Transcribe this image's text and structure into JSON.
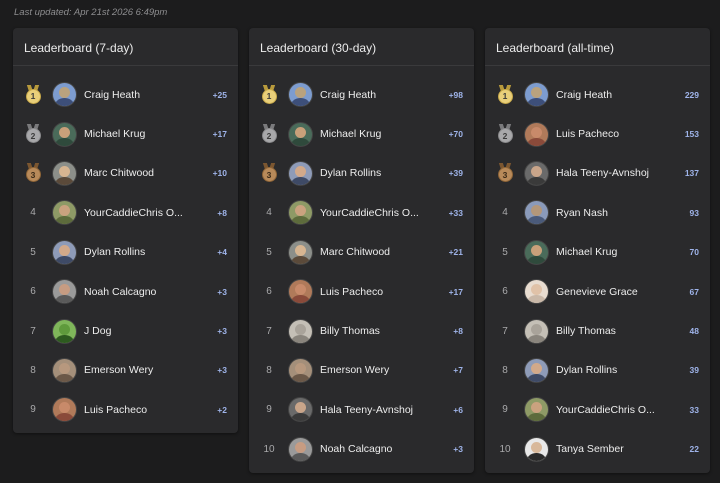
{
  "last_updated": "Last updated: Apr 21st 2026 6:49pm",
  "accent_color": "#9fb4ea",
  "medal_colors": {
    "gold": "#e9cf7a",
    "silver": "#a8a8aa",
    "bronze": "#b88a5a"
  },
  "boards": [
    {
      "title": "Leaderboard (7-day)",
      "rows": [
        {
          "rank": "1",
          "name": "Craig Heath",
          "score": "+25",
          "avatar": [
            "#b9a27e",
            "#3d4f7a",
            "#7d9ccf"
          ]
        },
        {
          "rank": "2",
          "name": "Michael Krug",
          "score": "+17",
          "avatar": [
            "#c9a07a",
            "#2f4a3c",
            "#4a6b5a"
          ]
        },
        {
          "rank": "3",
          "name": "Marc Chitwood",
          "score": "+10",
          "avatar": [
            "#d7b591",
            "#5b4a3a",
            "#8c8f8a"
          ]
        },
        {
          "rank": "4",
          "name": "YourCaddieChris O...",
          "score": "+8",
          "avatar": [
            "#caa27f",
            "#5d6b3c",
            "#8e9a66"
          ]
        },
        {
          "rank": "5",
          "name": "Dylan Rollins",
          "score": "+4",
          "avatar": [
            "#d2a98a",
            "#3e4a66",
            "#8e9bb8"
          ]
        },
        {
          "rank": "6",
          "name": "Noah Calcagno",
          "score": "+3",
          "avatar": [
            "#c79c82",
            "#5a5a5a",
            "#9a9a9a"
          ]
        },
        {
          "rank": "7",
          "name": "J Dog",
          "score": "+3",
          "avatar": [
            "#5f9a3c",
            "#2d5a1f",
            "#7fb65a"
          ]
        },
        {
          "rank": "8",
          "name": "Emerson Wery",
          "score": "+3",
          "avatar": [
            "#b7987e",
            "#6b5848",
            "#a48f7a"
          ]
        },
        {
          "rank": "9",
          "name": "Luis Pacheco",
          "score": "+2",
          "avatar": [
            "#c88a6a",
            "#8a4a3a",
            "#b07a5a"
          ]
        }
      ]
    },
    {
      "title": "Leaderboard (30-day)",
      "rows": [
        {
          "rank": "1",
          "name": "Craig Heath",
          "score": "+98",
          "avatar": [
            "#b9a27e",
            "#3d4f7a",
            "#7d9ccf"
          ]
        },
        {
          "rank": "2",
          "name": "Michael Krug",
          "score": "+70",
          "avatar": [
            "#c9a07a",
            "#2f4a3c",
            "#4a6b5a"
          ]
        },
        {
          "rank": "3",
          "name": "Dylan Rollins",
          "score": "+39",
          "avatar": [
            "#d2a98a",
            "#3e4a66",
            "#8e9bb8"
          ]
        },
        {
          "rank": "4",
          "name": "YourCaddieChris O...",
          "score": "+33",
          "avatar": [
            "#caa27f",
            "#5d6b3c",
            "#8e9a66"
          ]
        },
        {
          "rank": "5",
          "name": "Marc Chitwood",
          "score": "+21",
          "avatar": [
            "#d7b591",
            "#5b4a3a",
            "#8c8f8a"
          ]
        },
        {
          "rank": "6",
          "name": "Luis Pacheco",
          "score": "+17",
          "avatar": [
            "#c88a6a",
            "#8a4a3a",
            "#b07a5a"
          ]
        },
        {
          "rank": "7",
          "name": "Billy Thomas",
          "score": "+8",
          "avatar": [
            "#a9a39a",
            "#8a857d",
            "#c4bfb6"
          ]
        },
        {
          "rank": "8",
          "name": "Emerson Wery",
          "score": "+7",
          "avatar": [
            "#b7987e",
            "#6b5848",
            "#a48f7a"
          ]
        },
        {
          "rank": "9",
          "name": "Hala Teeny-Avnshoj",
          "score": "+6",
          "avatar": [
            "#c9a58a",
            "#3a3a3a",
            "#6a6a6a"
          ]
        },
        {
          "rank": "10",
          "name": "Noah Calcagno",
          "score": "+3",
          "avatar": [
            "#c79c82",
            "#5a5a5a",
            "#9a9a9a"
          ]
        }
      ]
    },
    {
      "title": "Leaderboard (all-time)",
      "rows": [
        {
          "rank": "1",
          "name": "Craig Heath",
          "score": "229",
          "avatar": [
            "#b9a27e",
            "#3d4f7a",
            "#7d9ccf"
          ]
        },
        {
          "rank": "2",
          "name": "Luis Pacheco",
          "score": "153",
          "avatar": [
            "#c88a6a",
            "#8a4a3a",
            "#b07a5a"
          ]
        },
        {
          "rank": "3",
          "name": "Hala Teeny-Avnshoj",
          "score": "137",
          "avatar": [
            "#c9a58a",
            "#3a3a3a",
            "#6a6a6a"
          ]
        },
        {
          "rank": "4",
          "name": "Ryan Nash",
          "score": "93",
          "avatar": [
            "#b3977a",
            "#4a5a7a",
            "#8a9aba"
          ]
        },
        {
          "rank": "5",
          "name": "Michael Krug",
          "score": "70",
          "avatar": [
            "#c9a07a",
            "#2f4a3c",
            "#4a6b5a"
          ]
        },
        {
          "rank": "6",
          "name": "Genevieve Grace",
          "score": "67",
          "avatar": [
            "#e0c2a8",
            "#c9b8a8",
            "#e8dcd0"
          ]
        },
        {
          "rank": "7",
          "name": "Billy Thomas",
          "score": "48",
          "avatar": [
            "#a9a39a",
            "#8a857d",
            "#c4bfb6"
          ]
        },
        {
          "rank": "8",
          "name": "Dylan Rollins",
          "score": "39",
          "avatar": [
            "#d2a98a",
            "#3e4a66",
            "#8e9bb8"
          ]
        },
        {
          "rank": "9",
          "name": "YourCaddieChris O...",
          "score": "33",
          "avatar": [
            "#caa27f",
            "#5d6b3c",
            "#8e9a66"
          ]
        },
        {
          "rank": "10",
          "name": "Tanya Sember",
          "score": "22",
          "avatar": [
            "#d8b89a",
            "#2a2a2a",
            "#e8e8e8"
          ]
        }
      ]
    }
  ]
}
